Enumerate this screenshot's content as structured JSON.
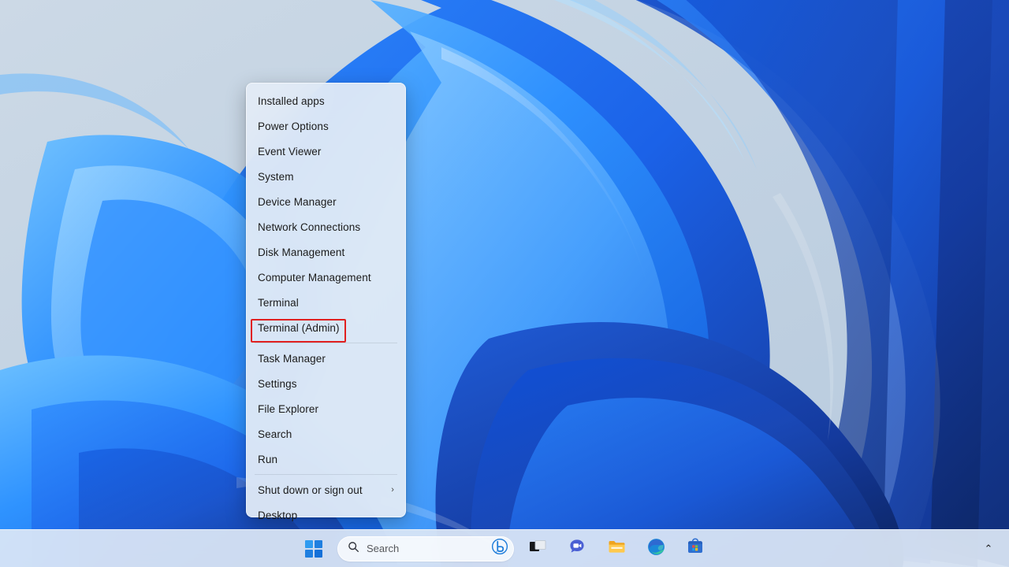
{
  "desktop": {
    "wallpaper_name": "windows-11-bloom-wallpaper",
    "background_color": "#c3d3e3"
  },
  "winx_menu": {
    "name": "win-x-quick-link-menu",
    "items": [
      {
        "label": "Installed apps",
        "submenu": false,
        "separator_after": false,
        "highlighted": false
      },
      {
        "label": "Power Options",
        "submenu": false,
        "separator_after": false,
        "highlighted": false
      },
      {
        "label": "Event Viewer",
        "submenu": false,
        "separator_after": false,
        "highlighted": false
      },
      {
        "label": "System",
        "submenu": false,
        "separator_after": false,
        "highlighted": false
      },
      {
        "label": "Device Manager",
        "submenu": false,
        "separator_after": false,
        "highlighted": false
      },
      {
        "label": "Network Connections",
        "submenu": false,
        "separator_after": false,
        "highlighted": false
      },
      {
        "label": "Disk Management",
        "submenu": false,
        "separator_after": false,
        "highlighted": false
      },
      {
        "label": "Computer Management",
        "submenu": false,
        "separator_after": false,
        "highlighted": false
      },
      {
        "label": "Terminal",
        "submenu": false,
        "separator_after": false,
        "highlighted": false
      },
      {
        "label": "Terminal (Admin)",
        "submenu": false,
        "separator_after": true,
        "highlighted": true
      },
      {
        "label": "Task Manager",
        "submenu": false,
        "separator_after": false,
        "highlighted": false
      },
      {
        "label": "Settings",
        "submenu": false,
        "separator_after": false,
        "highlighted": false
      },
      {
        "label": "File Explorer",
        "submenu": false,
        "separator_after": false,
        "highlighted": false
      },
      {
        "label": "Search",
        "submenu": false,
        "separator_after": false,
        "highlighted": false
      },
      {
        "label": "Run",
        "submenu": false,
        "separator_after": true,
        "highlighted": false
      },
      {
        "label": "Shut down or sign out",
        "submenu": true,
        "separator_after": false,
        "highlighted": false
      },
      {
        "label": "Desktop",
        "submenu": false,
        "separator_after": false,
        "highlighted": false
      }
    ],
    "submenu_chevron_glyph": "›",
    "highlight_color": "#e02020"
  },
  "taskbar": {
    "search": {
      "placeholder": "Search",
      "value": "",
      "search_icon": "search-icon",
      "copilot_icon": "bing-copilot-icon"
    },
    "buttons": [
      {
        "name": "start-button",
        "label": "Start"
      },
      {
        "name": "task-view-button",
        "label": "Task View"
      },
      {
        "name": "chat-button",
        "label": "Chat"
      },
      {
        "name": "file-explorer-button",
        "label": "File Explorer"
      },
      {
        "name": "microsoft-edge-button",
        "label": "Microsoft Edge"
      },
      {
        "name": "microsoft-store-button",
        "label": "Microsoft Store"
      }
    ],
    "tray": {
      "chevron_glyph": "⌃",
      "chevron_label": "Show hidden icons"
    },
    "background_color": "#dde8f6"
  }
}
